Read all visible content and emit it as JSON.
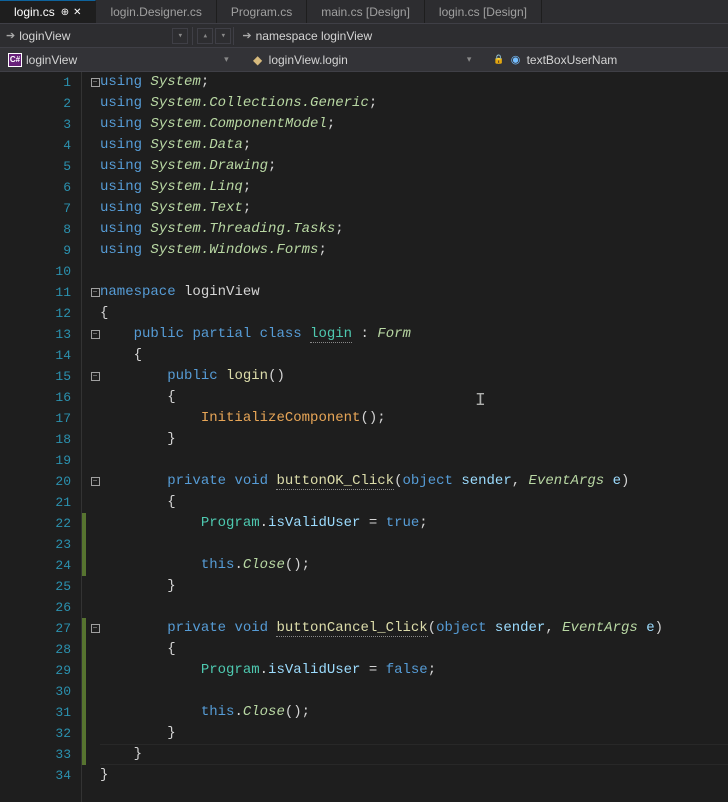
{
  "tabs": [
    {
      "label": "login.cs",
      "active": true
    },
    {
      "label": "login.Designer.cs"
    },
    {
      "label": "Program.cs"
    },
    {
      "label": "main.cs [Design]"
    },
    {
      "label": "login.cs [Design]"
    }
  ],
  "nav": {
    "scope": "loginView",
    "namespace": "namespace loginView"
  },
  "dropdowns": {
    "class": "loginView",
    "member": "loginView.login",
    "field": "textBoxUserNam"
  },
  "code": {
    "lines": [
      {
        "n": 1,
        "outline": "minus",
        "t": [
          [
            "kw",
            "using"
          ],
          [
            "punct",
            " "
          ],
          [
            "type",
            "System"
          ],
          [
            "punct",
            ";"
          ]
        ]
      },
      {
        "n": 2,
        "t": [
          [
            "kw",
            "using"
          ],
          [
            "punct",
            " "
          ],
          [
            "type",
            "System.Collections.Generic"
          ],
          [
            "punct",
            ";"
          ]
        ]
      },
      {
        "n": 3,
        "t": [
          [
            "kw",
            "using"
          ],
          [
            "punct",
            " "
          ],
          [
            "type",
            "System.ComponentModel"
          ],
          [
            "punct",
            ";"
          ]
        ]
      },
      {
        "n": 4,
        "t": [
          [
            "kw",
            "using"
          ],
          [
            "punct",
            " "
          ],
          [
            "type",
            "System.Data"
          ],
          [
            "punct",
            ";"
          ]
        ]
      },
      {
        "n": 5,
        "t": [
          [
            "kw",
            "using"
          ],
          [
            "punct",
            " "
          ],
          [
            "type",
            "System.Drawing"
          ],
          [
            "punct",
            ";"
          ]
        ]
      },
      {
        "n": 6,
        "t": [
          [
            "kw",
            "using"
          ],
          [
            "punct",
            " "
          ],
          [
            "type",
            "System.Linq"
          ],
          [
            "punct",
            ";"
          ]
        ]
      },
      {
        "n": 7,
        "t": [
          [
            "kw",
            "using"
          ],
          [
            "punct",
            " "
          ],
          [
            "type",
            "System.Text"
          ],
          [
            "punct",
            ";"
          ]
        ]
      },
      {
        "n": 8,
        "t": [
          [
            "kw",
            "using"
          ],
          [
            "punct",
            " "
          ],
          [
            "type",
            "System.Threading.Tasks"
          ],
          [
            "punct",
            ";"
          ]
        ]
      },
      {
        "n": 9,
        "t": [
          [
            "kw",
            "using"
          ],
          [
            "punct",
            " "
          ],
          [
            "type",
            "System.Windows.Forms"
          ],
          [
            "punct",
            ";"
          ]
        ]
      },
      {
        "n": 10,
        "t": []
      },
      {
        "n": 11,
        "outline": "minus",
        "t": [
          [
            "kw",
            "namespace"
          ],
          [
            "punct",
            " "
          ],
          [
            "ns",
            "loginView"
          ]
        ]
      },
      {
        "n": 12,
        "t": [
          [
            "punct",
            "{"
          ]
        ]
      },
      {
        "n": 13,
        "outline": "minus",
        "t": [
          [
            "punct",
            "    "
          ],
          [
            "kw",
            "public"
          ],
          [
            "punct",
            " "
          ],
          [
            "kw",
            "partial"
          ],
          [
            "punct",
            " "
          ],
          [
            "kw",
            "class"
          ],
          [
            "punct",
            " "
          ],
          [
            "type2",
            "login"
          ],
          [
            "punct",
            " : "
          ],
          [
            "type",
            "Form"
          ]
        ],
        "underline": "login"
      },
      {
        "n": 14,
        "t": [
          [
            "punct",
            "    {"
          ]
        ]
      },
      {
        "n": 15,
        "outline": "minus",
        "t": [
          [
            "punct",
            "        "
          ],
          [
            "kw",
            "public"
          ],
          [
            "punct",
            " "
          ],
          [
            "method",
            "login"
          ],
          [
            "punct",
            "()"
          ]
        ]
      },
      {
        "n": 16,
        "t": [
          [
            "punct",
            "        {"
          ]
        ]
      },
      {
        "n": 17,
        "t": [
          [
            "punct",
            "            "
          ],
          [
            "method-orange",
            "InitializeComponent"
          ],
          [
            "punct",
            "();"
          ]
        ]
      },
      {
        "n": 18,
        "t": [
          [
            "punct",
            "        }"
          ]
        ]
      },
      {
        "n": 19,
        "t": []
      },
      {
        "n": 20,
        "outline": "minus",
        "t": [
          [
            "punct",
            "        "
          ],
          [
            "kw",
            "private"
          ],
          [
            "punct",
            " "
          ],
          [
            "kw",
            "void"
          ],
          [
            "punct",
            " "
          ],
          [
            "method",
            "buttonOK_Click"
          ],
          [
            "punct",
            "("
          ],
          [
            "kw",
            "object"
          ],
          [
            "punct",
            " "
          ],
          [
            "param",
            "sender"
          ],
          [
            "punct",
            ", "
          ],
          [
            "type",
            "EventArgs"
          ],
          [
            "punct",
            " "
          ],
          [
            "param",
            "e"
          ],
          [
            "punct",
            ")"
          ]
        ],
        "underline": "buttonOK_Click"
      },
      {
        "n": 21,
        "t": [
          [
            "punct",
            "        {"
          ]
        ]
      },
      {
        "n": 22,
        "mark": true,
        "t": [
          [
            "punct",
            "            "
          ],
          [
            "type2",
            "Program"
          ],
          [
            "punct",
            "."
          ],
          [
            "param",
            "isValidUser"
          ],
          [
            "punct",
            " = "
          ],
          [
            "bool",
            "true"
          ],
          [
            "punct",
            ";"
          ]
        ]
      },
      {
        "n": 23,
        "mark": true,
        "t": []
      },
      {
        "n": 24,
        "mark": true,
        "t": [
          [
            "punct",
            "            "
          ],
          [
            "this",
            "this"
          ],
          [
            "punct",
            "."
          ],
          [
            "type",
            "Close"
          ],
          [
            "punct",
            "();"
          ]
        ]
      },
      {
        "n": 25,
        "t": [
          [
            "punct",
            "        }"
          ]
        ]
      },
      {
        "n": 26,
        "t": []
      },
      {
        "n": 27,
        "mark": true,
        "outline": "minus",
        "t": [
          [
            "punct",
            "        "
          ],
          [
            "kw",
            "private"
          ],
          [
            "punct",
            " "
          ],
          [
            "kw",
            "void"
          ],
          [
            "punct",
            " "
          ],
          [
            "method",
            "buttonCancel_Click"
          ],
          [
            "punct",
            "("
          ],
          [
            "kw",
            "object"
          ],
          [
            "punct",
            " "
          ],
          [
            "param",
            "sender"
          ],
          [
            "punct",
            ", "
          ],
          [
            "type",
            "EventArgs"
          ],
          [
            "punct",
            " "
          ],
          [
            "param",
            "e"
          ],
          [
            "punct",
            ")"
          ]
        ],
        "underline": "buttonCancel_Click"
      },
      {
        "n": 28,
        "mark": true,
        "t": [
          [
            "punct",
            "        {"
          ]
        ]
      },
      {
        "n": 29,
        "mark": true,
        "t": [
          [
            "punct",
            "            "
          ],
          [
            "type2",
            "Program"
          ],
          [
            "punct",
            "."
          ],
          [
            "param",
            "isValidUser"
          ],
          [
            "punct",
            " = "
          ],
          [
            "bool",
            "false"
          ],
          [
            "punct",
            ";"
          ]
        ]
      },
      {
        "n": 30,
        "mark": true,
        "t": []
      },
      {
        "n": 31,
        "mark": true,
        "t": [
          [
            "punct",
            "            "
          ],
          [
            "this",
            "this"
          ],
          [
            "punct",
            "."
          ],
          [
            "type",
            "Close"
          ],
          [
            "punct",
            "();"
          ]
        ]
      },
      {
        "n": 32,
        "mark": true,
        "t": [
          [
            "punct",
            "        }"
          ]
        ]
      },
      {
        "n": 33,
        "mark": true,
        "hl": true,
        "t": [
          [
            "punct",
            "    }"
          ]
        ]
      },
      {
        "n": 34,
        "t": [
          [
            "punct",
            "}"
          ]
        ]
      }
    ]
  }
}
